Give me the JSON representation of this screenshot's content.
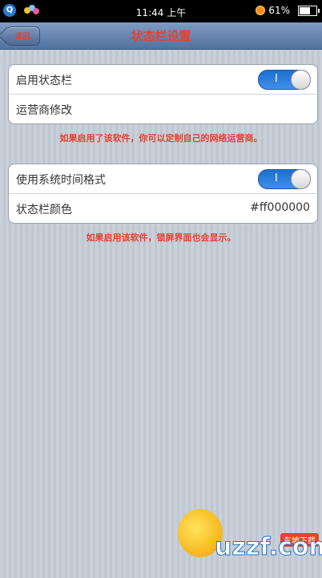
{
  "status_bar": {
    "time": "11:44 上午",
    "battery": "61%",
    "battery_level": 0.61
  },
  "nav": {
    "back_label": "返回",
    "title": "状态栏设置"
  },
  "group1": {
    "row1_label": "启用状态栏",
    "row1_switch": "I",
    "row2_label": "运营商修改"
  },
  "note1": "如果启用了该软件，你可以定制自己的网络运营商。",
  "group2": {
    "row1_label": "使用系统时间格式",
    "row1_switch": "I",
    "row2_label": "状态栏颜色",
    "row2_value": "#ff000000"
  },
  "note2": "如果启用该软件，锁屏界面也会显示。",
  "watermark": {
    "brand": "uzzf.com",
    "tag": "东坡下载"
  },
  "colors": {
    "accent_red": "#e8402f",
    "switch_blue": "#1c6ed0",
    "navbar": "#51729f"
  }
}
